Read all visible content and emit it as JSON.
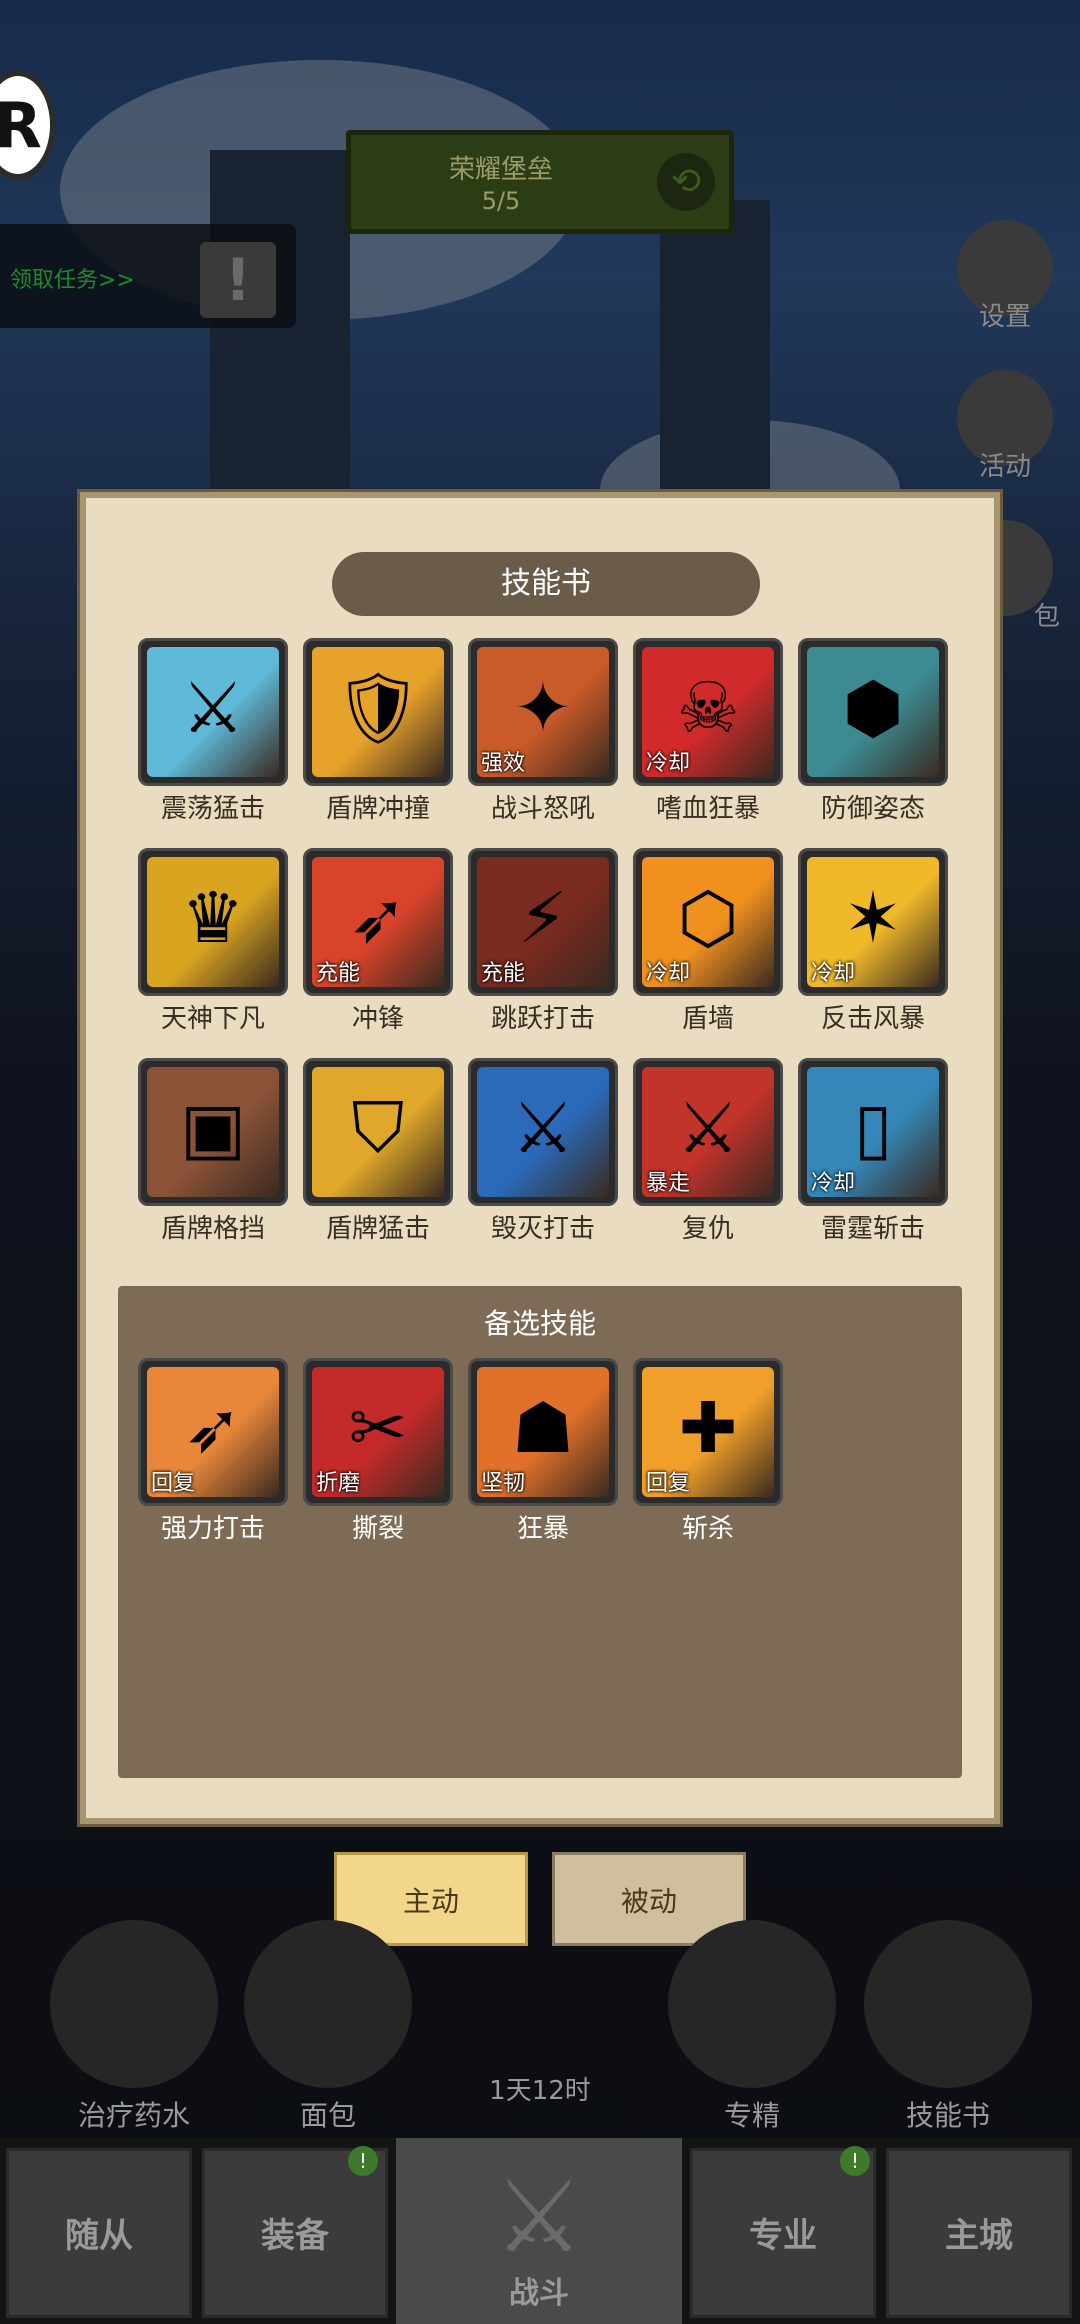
{
  "header": {
    "avatar_letter": "R",
    "quest_label": "领取任务>>",
    "quest_alert": "!",
    "stage_name": "荣耀堡垒",
    "stage_progress": "5/5",
    "settings_label": "设置",
    "activity_label": "活动",
    "bag_label": "包"
  },
  "modal": {
    "title": "技能书",
    "skills": [
      {
        "name": "震荡猛击",
        "tag": "",
        "color": "#5fb9d8",
        "glyph": "⚔"
      },
      {
        "name": "盾牌冲撞",
        "tag": "",
        "color": "#e7a22a",
        "glyph": "🛡"
      },
      {
        "name": "战斗怒吼",
        "tag": "强效",
        "color": "#c95a2a",
        "glyph": "✦"
      },
      {
        "name": "嗜血狂暴",
        "tag": "冷却",
        "color": "#d12a2a",
        "glyph": "☠"
      },
      {
        "name": "防御姿态",
        "tag": "",
        "color": "#3c8b93",
        "glyph": "⬢"
      },
      {
        "name": "天神下凡",
        "tag": "",
        "color": "#d9a420",
        "glyph": "♛"
      },
      {
        "name": "冲锋",
        "tag": "充能",
        "color": "#d8432a",
        "glyph": "➶"
      },
      {
        "name": "跳跃打击",
        "tag": "充能",
        "color": "#7a2a1f",
        "glyph": "⚡"
      },
      {
        "name": "盾墙",
        "tag": "冷却",
        "color": "#f0901f",
        "glyph": "⬡"
      },
      {
        "name": "反击风暴",
        "tag": "冷却",
        "color": "#f0b92a",
        "glyph": "✶"
      },
      {
        "name": "盾牌格挡",
        "tag": "",
        "color": "#8a5236",
        "glyph": "▣"
      },
      {
        "name": "盾牌猛击",
        "tag": "",
        "color": "#e0a82a",
        "glyph": "⛉"
      },
      {
        "name": "毁灭打击",
        "tag": "",
        "color": "#2a6ab8",
        "glyph": "⚔"
      },
      {
        "name": "复仇",
        "tag": "暴走",
        "color": "#c2332a",
        "glyph": "⚔"
      },
      {
        "name": "雷霆斩击",
        "tag": "冷却",
        "color": "#3487b8",
        "glyph": "▯"
      }
    ],
    "bench_title": "备选技能",
    "bench_skills": [
      {
        "name": "强力打击",
        "tag": "回复",
        "color": "#e8873a",
        "glyph": "➶"
      },
      {
        "name": "撕裂",
        "tag": "折磨",
        "color": "#c52a2a",
        "glyph": "✂"
      },
      {
        "name": "狂暴",
        "tag": "坚韧",
        "color": "#e0702a",
        "glyph": "☗"
      },
      {
        "name": "斩杀",
        "tag": "回复",
        "color": "#f0a02a",
        "glyph": "✚"
      }
    ]
  },
  "tabs": {
    "active": "主动",
    "passive": "被动"
  },
  "quick": {
    "potion": "治疗药水",
    "bread": "面包",
    "timer": "1天12时",
    "mastery": "专精",
    "skillbook": "技能书"
  },
  "nav": {
    "followers": "随从",
    "equipment": "装备",
    "battle": "战斗",
    "profession": "专业",
    "main_city": "主城",
    "badge": "!"
  }
}
